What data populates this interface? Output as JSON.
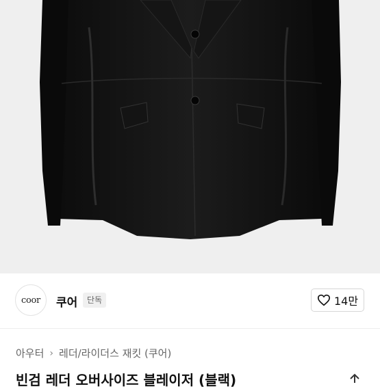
{
  "product_image": {
    "alt": "black leather oversized blazer",
    "background": "#efefef"
  },
  "brand": {
    "logo_text": "coor",
    "name": "쿠어",
    "badge": "단독"
  },
  "like": {
    "count": "14만"
  },
  "breadcrumb": {
    "category": "아우터",
    "subcategory": "레더/라이더스 재킷 (쿠어)"
  },
  "product": {
    "title": "빈검 레더 오버사이즈 블레이저 (블랙)"
  },
  "colors": {
    "accent": "#111111",
    "badge_bg": "#f0f0f0"
  }
}
